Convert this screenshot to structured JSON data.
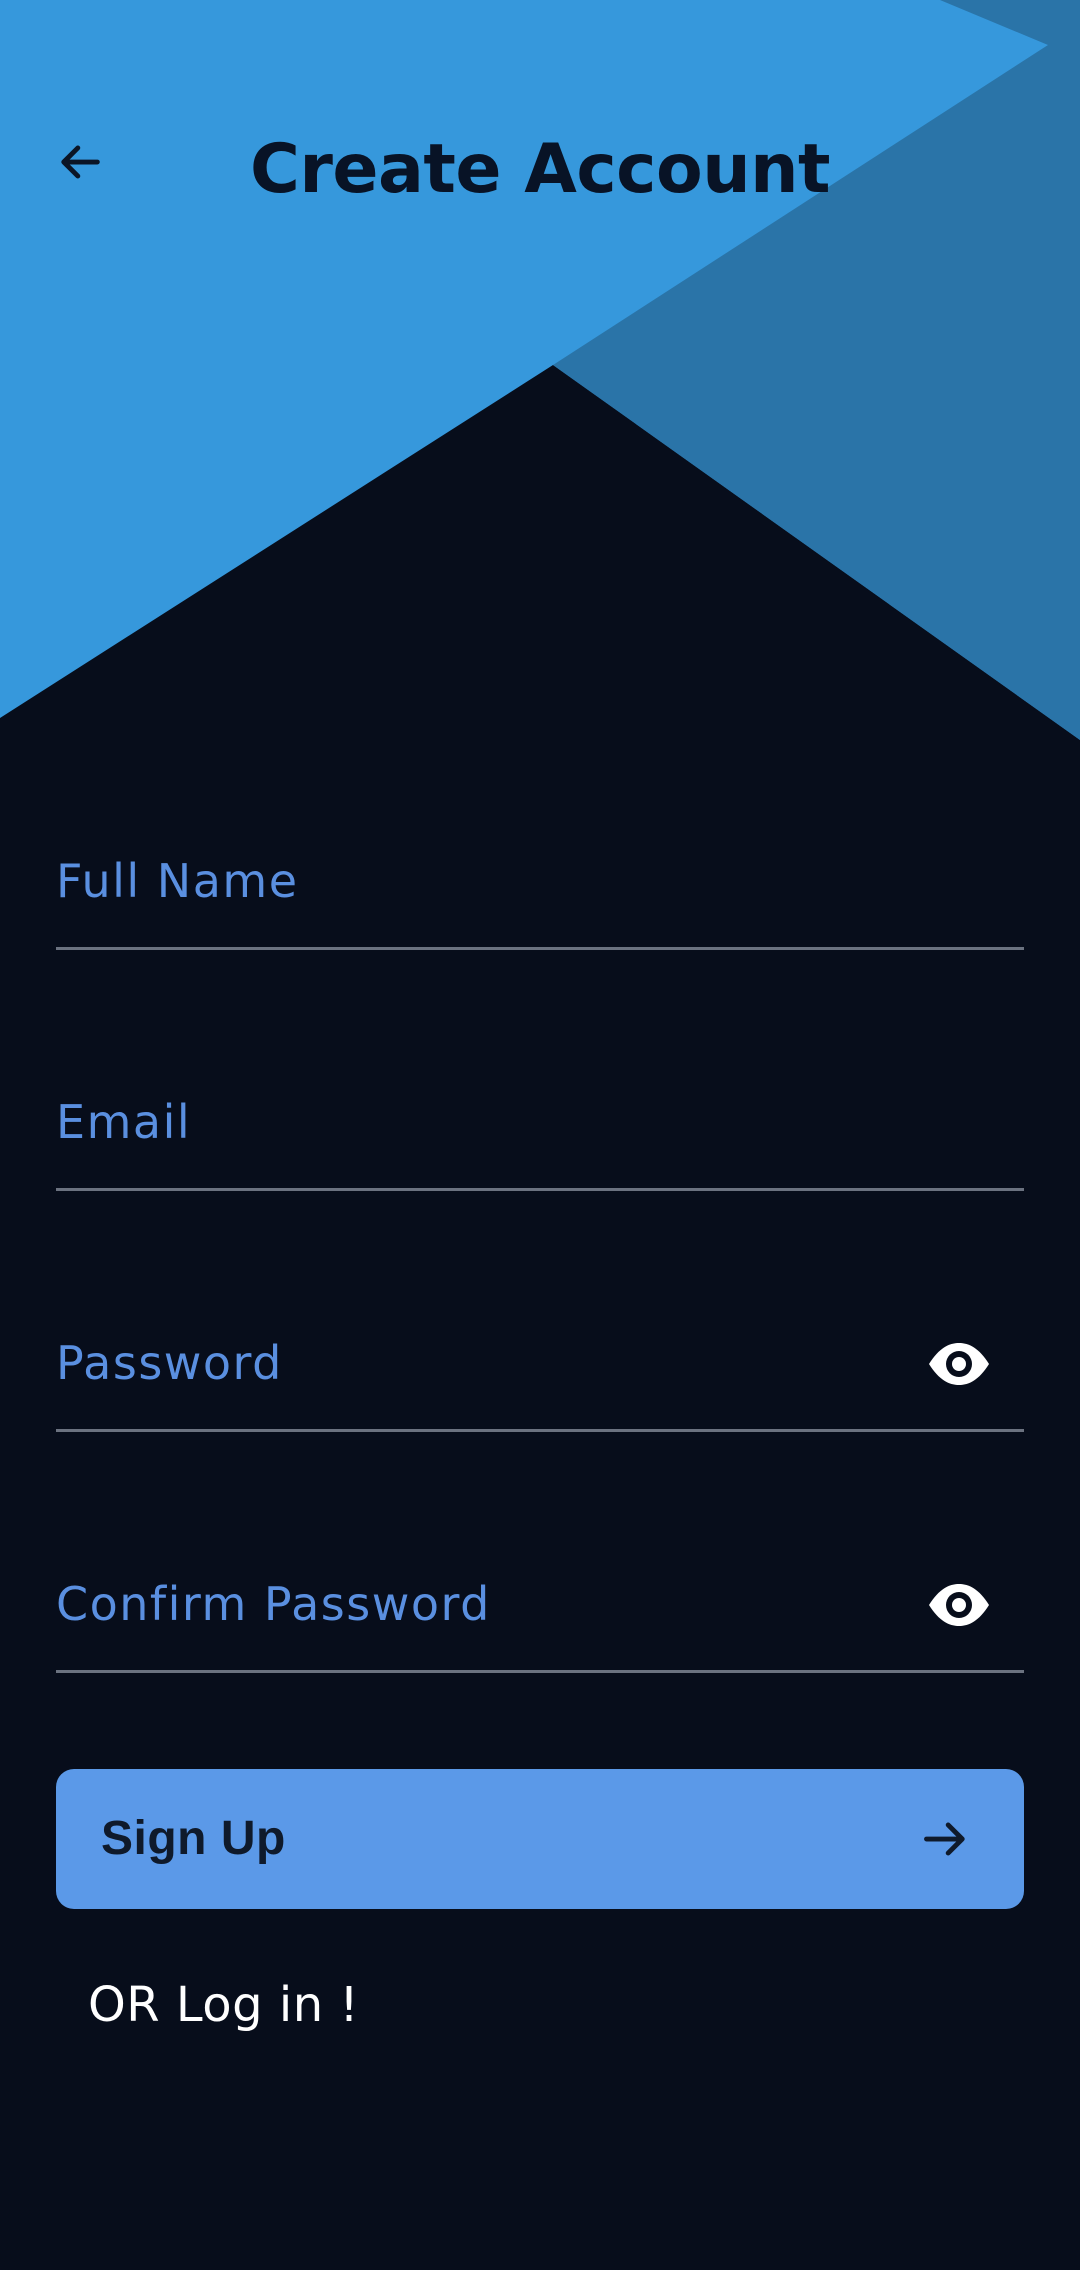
{
  "header": {
    "title": "Create Account",
    "back_icon": "arrow-left-icon"
  },
  "form": {
    "full_name": {
      "placeholder": "Full Name",
      "value": ""
    },
    "email": {
      "placeholder": "Email",
      "value": ""
    },
    "password": {
      "placeholder": "Password",
      "value": "",
      "toggle_icon": "eye-icon"
    },
    "confirm_password": {
      "placeholder": "Confirm Password",
      "value": "",
      "toggle_icon": "eye-icon"
    }
  },
  "signup": {
    "label": "Sign Up",
    "icon": "arrow-right-icon"
  },
  "login_link": "OR Log in !",
  "colors": {
    "background": "#070d1b",
    "header_blue": "#3698dc",
    "header_dark_blue": "#2a74a8",
    "accent": "#5b99e8",
    "placeholder": "#5a8fe0",
    "title_text": "#081326"
  }
}
